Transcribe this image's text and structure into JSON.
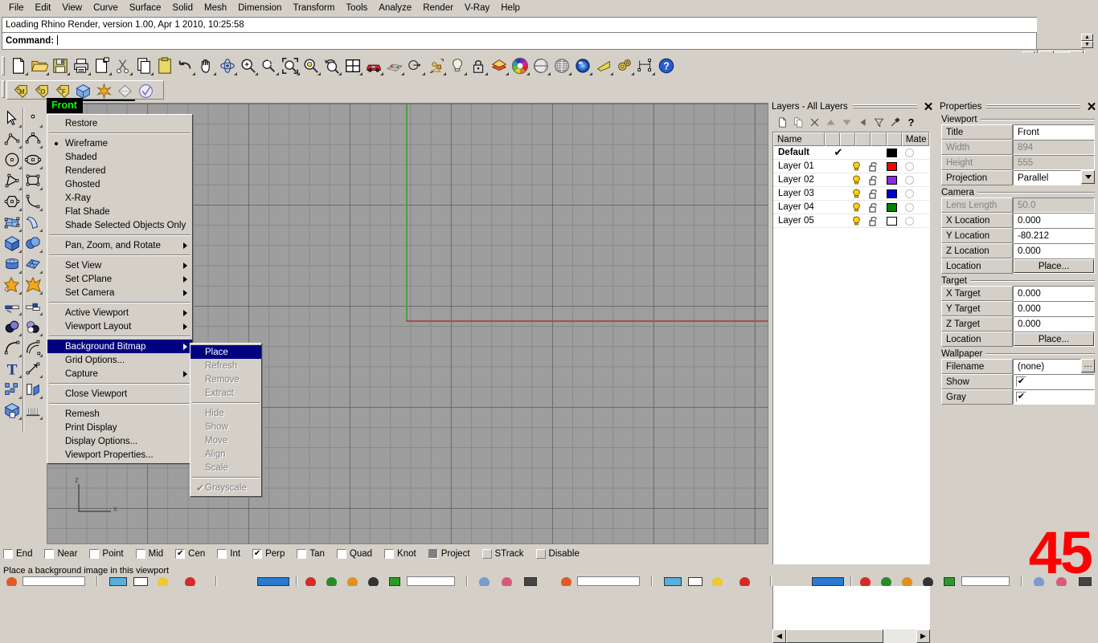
{
  "menubar": {
    "items": [
      "File",
      "Edit",
      "View",
      "Curve",
      "Surface",
      "Solid",
      "Mesh",
      "Dimension",
      "Transform",
      "Tools",
      "Analyze",
      "Render",
      "V-Ray",
      "Help"
    ]
  },
  "command": {
    "history": "Loading Rhino Render, version 1.00, Apr  1 2010, 10:25:58",
    "prompt": "Command:",
    "value": ""
  },
  "toolbar_main": {
    "icons": [
      "new-file-icon",
      "open-folder-icon",
      "save-icon",
      "print-icon",
      "print-preview-icon",
      "cut-scissors-icon",
      "copy-icon",
      "paste-clipboard-icon",
      "undo-icon",
      "pan-hand-icon",
      "rotate-view-icon",
      "zoom-in-icon",
      "zoom-window-icon",
      "zoom-extents-icon",
      "zoom-selected-icon",
      "zoom-previous-icon",
      "viewport-layout-icon",
      "render-icon",
      "render-mesh-icon",
      "shadow-icon",
      "light-properties-icon",
      "lightbulb-icon",
      "lock-icon",
      "material-icon",
      "color-wheel-icon",
      "sphere-shaded-icon",
      "sphere-wireframe-icon",
      "sphere-rendered-icon",
      "flat-shade-icon",
      "options-gears-icon",
      "dimension-icon",
      "help-icon"
    ]
  },
  "toolbar_secondary": {
    "icons": [
      "material-tag-icon",
      "object-tag-icon",
      "face-tag-icon",
      "block-icon",
      "snapshot-icon",
      "diamond-icon",
      "check-circle-icon"
    ]
  },
  "sidebar": {
    "icons": [
      "select-arrow-icon",
      "point-icon",
      "polyline-icon",
      "curve-interp-icon",
      "circle-icon",
      "ellipse-icon",
      "polygon-arc-icon",
      "rectangle-icon",
      "hexagon-icon",
      "curve-arc-icon",
      "surface-patch-icon",
      "surface-sweep-icon",
      "box-icon",
      "boolean-spheres-icon",
      "cylinder-icon",
      "surface-array-icon",
      "explode-star-icon",
      "boolean-union-icon",
      "trim-icon",
      "split-icon",
      "boolean-difference-icon",
      "boolean-intersection-icon",
      "fillet-curve-icon",
      "offset-curve-icon",
      "text-tool-icon",
      "scale-icon",
      "array-icon",
      "extrude-icon",
      "solid-edit-icon",
      "mesh-tools-icon"
    ]
  },
  "viewport": {
    "title": "Front",
    "axis_x_label": "x",
    "axis_z_label": "z",
    "axis_y_color": "#4f9a4f",
    "axis_x_color": "#a45050",
    "background": "#9e9e9e"
  },
  "context_menu": {
    "groups": [
      [
        {
          "label": "Restore",
          "state": "normal"
        }
      ],
      [
        {
          "label": "Wireframe",
          "state": "normal",
          "marker": "bullet"
        },
        {
          "label": "Shaded",
          "state": "normal"
        },
        {
          "label": "Rendered",
          "state": "normal"
        },
        {
          "label": "Ghosted",
          "state": "normal"
        },
        {
          "label": "X-Ray",
          "state": "normal"
        },
        {
          "label": "Flat Shade",
          "state": "normal"
        },
        {
          "label": "Shade Selected Objects Only",
          "state": "normal"
        }
      ],
      [
        {
          "label": "Pan, Zoom, and Rotate",
          "state": "normal",
          "submenu": true
        }
      ],
      [
        {
          "label": "Set View",
          "state": "normal",
          "submenu": true
        },
        {
          "label": "Set CPlane",
          "state": "normal",
          "submenu": true
        },
        {
          "label": "Set Camera",
          "state": "normal",
          "submenu": true
        }
      ],
      [
        {
          "label": "Active Viewport",
          "state": "normal",
          "submenu": true
        },
        {
          "label": "Viewport Layout",
          "state": "normal",
          "submenu": true
        }
      ],
      [
        {
          "label": "Background Bitmap",
          "state": "selected",
          "submenu": true
        },
        {
          "label": "Grid Options...",
          "state": "normal"
        },
        {
          "label": "Capture",
          "state": "normal",
          "submenu": true
        }
      ],
      [
        {
          "label": "Close Viewport",
          "state": "normal"
        }
      ],
      [
        {
          "label": "Remesh",
          "state": "normal"
        },
        {
          "label": "Print Display",
          "state": "normal"
        },
        {
          "label": "Display Options...",
          "state": "normal"
        },
        {
          "label": "Viewport Properties...",
          "state": "normal"
        }
      ]
    ]
  },
  "submenu": {
    "groups": [
      [
        {
          "label": "Place",
          "state": "selected"
        },
        {
          "label": "Refresh",
          "state": "disabled"
        },
        {
          "label": "Remove",
          "state": "disabled"
        },
        {
          "label": "Extract",
          "state": "disabled"
        }
      ],
      [
        {
          "label": "Hide",
          "state": "disabled"
        },
        {
          "label": "Show",
          "state": "disabled"
        },
        {
          "label": "Move",
          "state": "disabled"
        },
        {
          "label": "Align",
          "state": "disabled"
        },
        {
          "label": "Scale",
          "state": "disabled"
        }
      ],
      [
        {
          "label": "Grayscale",
          "state": "disabled",
          "marker": "check"
        }
      ]
    ]
  },
  "layers_panel": {
    "title": "Layers - All Layers",
    "close_label": "✕",
    "tool_icons": [
      "new-layer-icon",
      "duplicate-layer-icon",
      "delete-layer-icon",
      "move-up-icon",
      "move-down-icon",
      "move-left-icon",
      "filter-icon",
      "layer-tools-icon",
      "help-icon"
    ],
    "tool_glyphs": [
      "❐",
      "❐",
      "✕",
      "▲",
      "▼",
      "◀",
      "▽",
      "⚒",
      "?"
    ],
    "columns": [
      "Name",
      "",
      "",
      "",
      "",
      "",
      "Mate"
    ],
    "rows": [
      {
        "name": "Default",
        "current": true,
        "check": "✔",
        "light": "",
        "lock": "",
        "color": "#000000",
        "material": ""
      },
      {
        "name": "Layer 01",
        "current": false,
        "check": "",
        "light": "bulb",
        "lock": "unlocked",
        "color": "#ff0000",
        "material": ""
      },
      {
        "name": "Layer 02",
        "current": false,
        "check": "",
        "light": "bulb",
        "lock": "unlocked",
        "color": "#8a2be2",
        "material": ""
      },
      {
        "name": "Layer 03",
        "current": false,
        "check": "",
        "light": "bulb",
        "lock": "unlocked",
        "color": "#0000cc",
        "material": ""
      },
      {
        "name": "Layer 04",
        "current": false,
        "check": "",
        "light": "bulb",
        "lock": "unlocked",
        "color": "#008000",
        "material": ""
      },
      {
        "name": "Layer 05",
        "current": false,
        "check": "",
        "light": "bulb",
        "lock": "unlocked",
        "color": "#ffffff",
        "material": ""
      }
    ]
  },
  "properties_panel": {
    "title": "Properties",
    "close_label": "✕",
    "sections": [
      {
        "label": "Viewport",
        "rows": [
          {
            "label": "Title",
            "value": "Front",
            "type": "text",
            "disabled": false
          },
          {
            "label": "Width",
            "value": "894",
            "type": "text",
            "disabled": true
          },
          {
            "label": "Height",
            "value": "555",
            "type": "text",
            "disabled": true
          },
          {
            "label": "Projection",
            "value": "Parallel",
            "type": "dropdown",
            "disabled": false
          }
        ]
      },
      {
        "label": "Camera",
        "rows": [
          {
            "label": "Lens Length",
            "value": "50.0",
            "type": "text",
            "disabled": true
          },
          {
            "label": "X Location",
            "value": "0.000",
            "type": "text",
            "disabled": false
          },
          {
            "label": "Y Location",
            "value": "-80.212",
            "type": "text",
            "disabled": false
          },
          {
            "label": "Z Location",
            "value": "0.000",
            "type": "text",
            "disabled": false
          },
          {
            "label": "Location",
            "value": "Place...",
            "type": "button",
            "disabled": false
          }
        ]
      },
      {
        "label": "Target",
        "rows": [
          {
            "label": "X Target",
            "value": "0.000",
            "type": "text",
            "disabled": false
          },
          {
            "label": "Y Target",
            "value": "0.000",
            "type": "text",
            "disabled": false
          },
          {
            "label": "Z Target",
            "value": "0.000",
            "type": "text",
            "disabled": false
          },
          {
            "label": "Location",
            "value": "Place...",
            "type": "button",
            "disabled": false
          }
        ]
      },
      {
        "label": "Wallpaper",
        "rows": [
          {
            "label": "Filename",
            "value": "(none)",
            "type": "file",
            "disabled": false
          },
          {
            "label": "Show",
            "value": "✔",
            "type": "checkbox",
            "disabled": false
          },
          {
            "label": "Gray",
            "value": "✔",
            "type": "checkbox",
            "disabled": false
          }
        ]
      }
    ]
  },
  "osnap": {
    "items": [
      {
        "label": "End",
        "checked": false,
        "style": "box"
      },
      {
        "label": "Near",
        "checked": false,
        "style": "box"
      },
      {
        "label": "Point",
        "checked": false,
        "style": "box"
      },
      {
        "label": "Mid",
        "checked": false,
        "style": "box"
      },
      {
        "label": "Cen",
        "checked": true,
        "style": "box"
      },
      {
        "label": "Int",
        "checked": false,
        "style": "box"
      },
      {
        "label": "Perp",
        "checked": true,
        "style": "box"
      },
      {
        "label": "Tan",
        "checked": false,
        "style": "box"
      },
      {
        "label": "Quad",
        "checked": false,
        "style": "box"
      },
      {
        "label": "Knot",
        "checked": false,
        "style": "box"
      },
      {
        "label": "Project",
        "checked": false,
        "style": "gray"
      },
      {
        "label": "STrack",
        "checked": false,
        "style": "flat"
      },
      {
        "label": "Disable",
        "checked": false,
        "style": "flat"
      }
    ],
    "check_glyph": "✔"
  },
  "statusbar": {
    "message": "Place a background image in this viewport"
  },
  "overlay": {
    "number": "45",
    "color": "#ff0000"
  }
}
